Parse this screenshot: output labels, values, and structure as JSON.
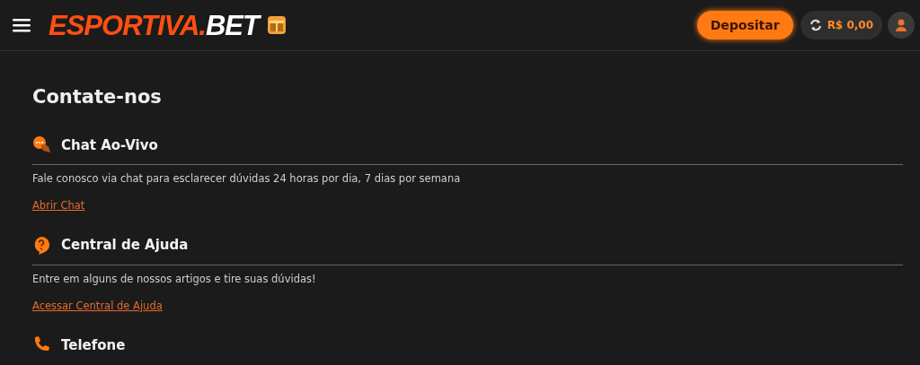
{
  "header": {
    "logo": {
      "primary": "ESPORTIVA.",
      "secondary": "BET"
    },
    "deposit_button": "Depositar",
    "balance": "R$ 0,00"
  },
  "page_title": "Contate-nos",
  "sections": [
    {
      "kind": "chat",
      "title": "Chat Ao-Vivo",
      "description": "Fale conosco via chat para esclarecer dúvidas 24 horas por dia, 7 dias por semana",
      "link": "Abrir Chat"
    },
    {
      "kind": "help",
      "title": "Central de Ajuda",
      "description": "Entre em alguns de nossos artigos e tire suas dúvidas!",
      "link": "Acessar Central de Ajuda"
    },
    {
      "kind": "phone",
      "title": "Telefone"
    }
  ]
}
